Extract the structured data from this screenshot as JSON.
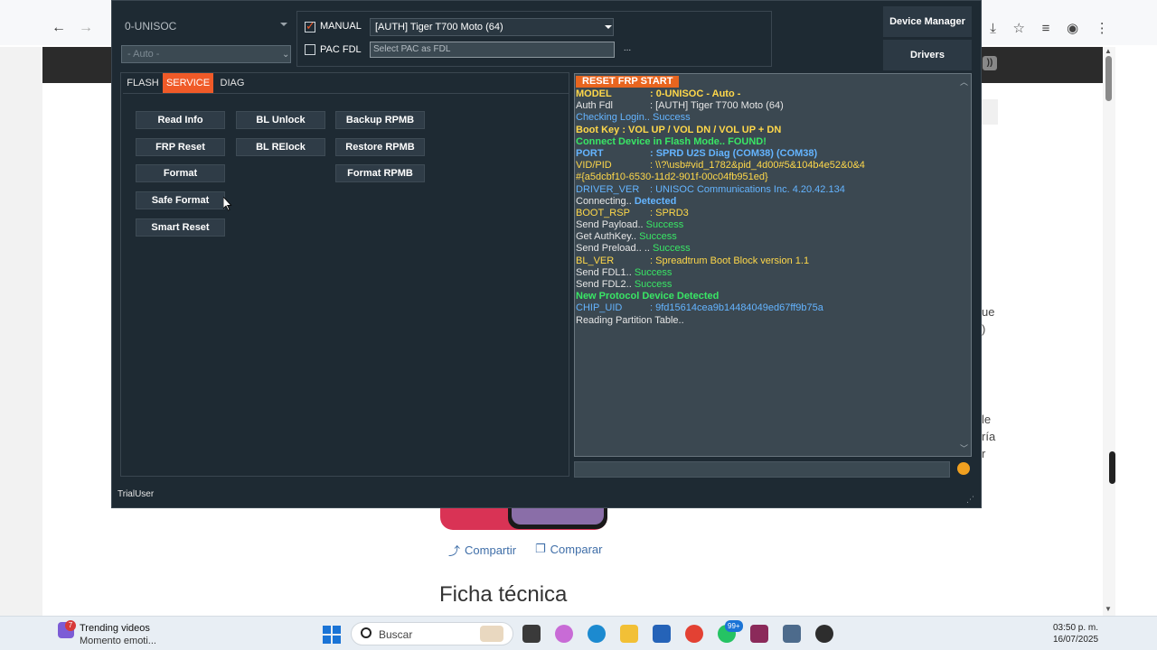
{
  "app": {
    "platform": "0-UNISOC",
    "mode": "- Auto -",
    "manual_label": "MANUAL",
    "manual_checked": true,
    "pacfdl_label": "PAC FDL",
    "pacfdl_checked": false,
    "fdl_selected": "[AUTH] Tiger T700 Moto (64)",
    "pac_placeholder": "Select PAC as FDL",
    "pac_browse": "...",
    "side_buttons": {
      "device_manager": "Device Manager",
      "drivers": "Drivers"
    },
    "tabs": {
      "flash": "FLASH",
      "service": "SERVICE",
      "diag": "DIAG",
      "active": "SERVICE"
    },
    "service_buttons": {
      "read_info": "Read Info",
      "frp_reset": "FRP Reset",
      "format": "Format",
      "safe_format": "Safe Format",
      "smart_reset": "Smart Reset",
      "bl_unlock": "BL Unlock",
      "bl_relock": "BL RElock",
      "backup_rpmb": "Backup RPMB",
      "restore_rpmb": "Restore RPMB",
      "format_rpmb": "Format RPMB"
    },
    "log": {
      "header": "RESET FRP START",
      "lines": [
        {
          "key": "MODEL",
          "value": ": 0-UNISOC - Auto -"
        },
        {
          "key": "Auth Fdl",
          "value": ": [AUTH] Tiger T700 Moto (64)"
        },
        {
          "key": "Checking Login..",
          "value": " Success"
        },
        {
          "key": "Boot Key : VOL UP / VOL DN / VOL UP + DN",
          "value": ""
        },
        {
          "key": "Connect Device in Flash Mode..",
          "value": " FOUND!"
        },
        {
          "key": "PORT",
          "value": ": SPRD U2S Diag (COM38) (COM38)"
        },
        {
          "key": "VID/PID",
          "value": ": \\\\?\\usb#vid_1782&pid_4d00#5&104b4e52&0&4"
        },
        {
          "key": "#{a5dcbf10-6530-11d2-901f-00c04fb951ed}",
          "value": ""
        },
        {
          "key": "DRIVER_VER",
          "value": ": UNISOC Communications Inc.  4.20.42.134"
        },
        {
          "key": "Connecting..",
          "value": " Detected"
        },
        {
          "key": "BOOT_RSP",
          "value": ": SPRD3"
        },
        {
          "key": "Send Payload..",
          "value": " Success"
        },
        {
          "key": "Get AuthKey..",
          "value": " Success"
        },
        {
          "key": "Send Preload.. ..",
          "value": " Success"
        },
        {
          "key": "BL_VER",
          "value": ": Spreadtrum Boot Block version 1.1"
        },
        {
          "key": "Send FDL1..",
          "value": " Success"
        },
        {
          "key": "Send FDL2..",
          "value": " Success"
        },
        {
          "key": "New Protocol Device Detected",
          "value": ""
        },
        {
          "key": "CHIP_UID",
          "value": ": 9fd15614cea9b14484049ed67ff9b75a"
        },
        {
          "key": "Reading Partition Table..",
          "value": ""
        }
      ]
    },
    "status_user": "TrialUser"
  },
  "colors": {
    "accent": "#f05a28",
    "window_bg": "#1e2a33",
    "log_bg": "#3b4851",
    "log_yellow": "#ffd84a",
    "log_green": "#39e665",
    "log_blue": "#64b4ff"
  },
  "browser": {
    "links": {
      "share": "Compartir",
      "compare": "Comparar"
    },
    "section_title": "Ficha técnica",
    "peek_texts": [
      "ue",
      ")",
      "le",
      "ría",
      "r"
    ]
  },
  "taskbar": {
    "widget_badge": "7",
    "widget_title": "Trending videos",
    "widget_subtitle": "Momento emoti...",
    "search_label": "Buscar",
    "app_badge": "99+",
    "time": "03:50 p. m.",
    "date": "16/07/2025"
  }
}
